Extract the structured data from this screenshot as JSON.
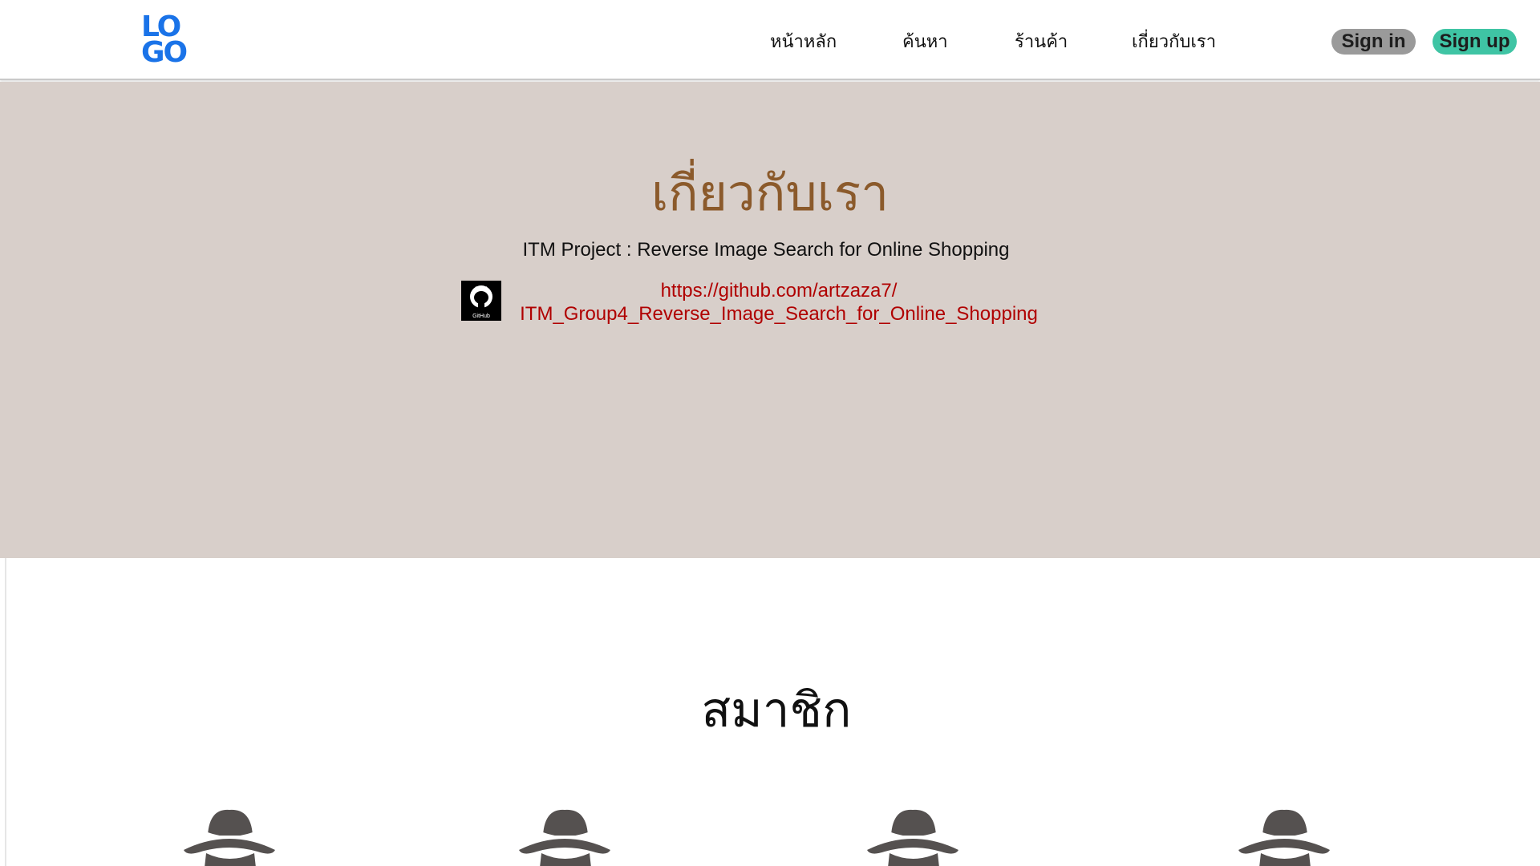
{
  "header": {
    "logo_line1": "LO",
    "logo_line2": "GO",
    "nav": [
      "หน้าหลัก",
      "ค้นหา",
      "ร้านค้า",
      "เกี่ยวกับเรา"
    ],
    "signin_label": "Sign in",
    "signup_label": "Sign up"
  },
  "hero": {
    "title": "เกี่ยวกับเรา",
    "subtitle": "ITM Project : Reverse Image Search for Online Shopping",
    "github_icon": "github-icon",
    "github_icon_text": "GitHub",
    "link_line1": "https://github.com/artzaza7/",
    "link_line2": "ITM_Group4_Reverse_Image_Search_for_Online_Shopping"
  },
  "members": {
    "title": "สมาชิก",
    "avatar_icon": "spy-avatar-icon",
    "count": 4
  },
  "colors": {
    "logo": "#1a73e8",
    "hero_bg": "#d8cfca",
    "hero_title": "#8b5a2b",
    "link": "#b00000",
    "signin_bg": "#9a9a9a",
    "signup_bg": "#3fc4a4"
  }
}
